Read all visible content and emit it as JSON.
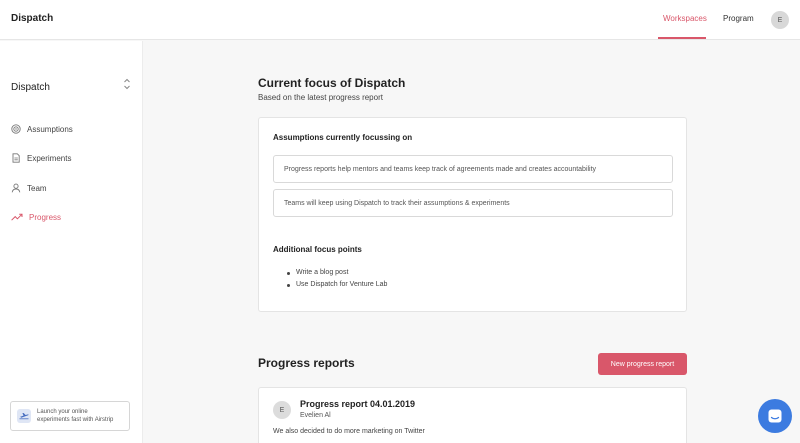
{
  "header": {
    "brand": "Dispatch",
    "nav": {
      "workspaces": "Workspaces",
      "program": "Program"
    },
    "avatar_initial": "E",
    "accent": "#d9576a"
  },
  "sidebar": {
    "workspace": "Dispatch",
    "items": [
      {
        "label": "Assumptions",
        "icon": "target-icon",
        "active": false
      },
      {
        "label": "Experiments",
        "icon": "document-icon",
        "active": false
      },
      {
        "label": "Team",
        "icon": "user-icon",
        "active": false
      },
      {
        "label": "Progress",
        "icon": "trending-up-icon",
        "active": true
      }
    ],
    "promo": {
      "line1": "Launch your online",
      "line2": "experiments fast with Airstrip"
    }
  },
  "main": {
    "title": "Current focus of Dispatch",
    "subtitle": "Based on the latest progress report",
    "focus_card": {
      "assumptions_heading": "Assumptions currently focussing on",
      "assumptions": [
        "Progress reports help mentors and teams keep track of agreements made and creates accountability",
        "Teams will keep using Dispatch to track their assumptions & experiments"
      ],
      "additional_heading": "Additional focus points",
      "additional": [
        "Write a blog post",
        "Use Dispatch for Venture Lab"
      ]
    },
    "reports": {
      "title": "Progress reports",
      "new_button": "New progress report",
      "items": [
        {
          "avatar": "E",
          "title": "Progress report 04.01.2019",
          "author": "Evelien Al",
          "body": "We also decided to do more marketing on Twitter"
        }
      ]
    }
  },
  "chat": {
    "icon": "chat-icon",
    "color": "#3c7be0"
  }
}
